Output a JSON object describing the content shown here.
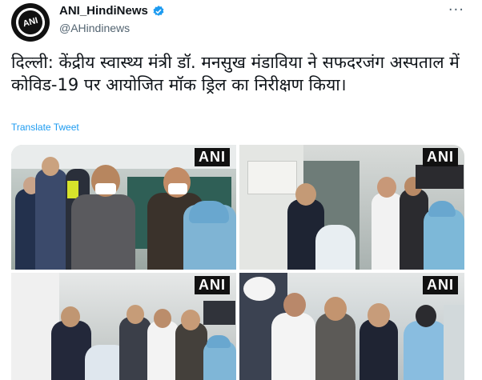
{
  "author": {
    "display_name": "ANI_HindiNews",
    "handle": "@AHindinews",
    "avatar_text": "ANI",
    "verified": true
  },
  "tweet": {
    "text": "दिल्ली: केंद्रीय स्वास्थ्य मंत्री डॉ. मनसुख मंडाविया ने सफदरजंग अस्पताल में कोविड-19 पर आयोजित मॉक ड्रिल का निरीक्षण किया।",
    "translate_label": "Translate Tweet"
  },
  "media": {
    "watermark": "ANI",
    "photos": [
      {
        "id": "photo-1"
      },
      {
        "id": "photo-2"
      },
      {
        "id": "photo-3"
      },
      {
        "id": "photo-4"
      }
    ]
  },
  "more_icon": "ellipsis-icon",
  "colors": {
    "link": "#1d9bf0",
    "verified": "#1d9bf0",
    "muted": "#536471"
  }
}
